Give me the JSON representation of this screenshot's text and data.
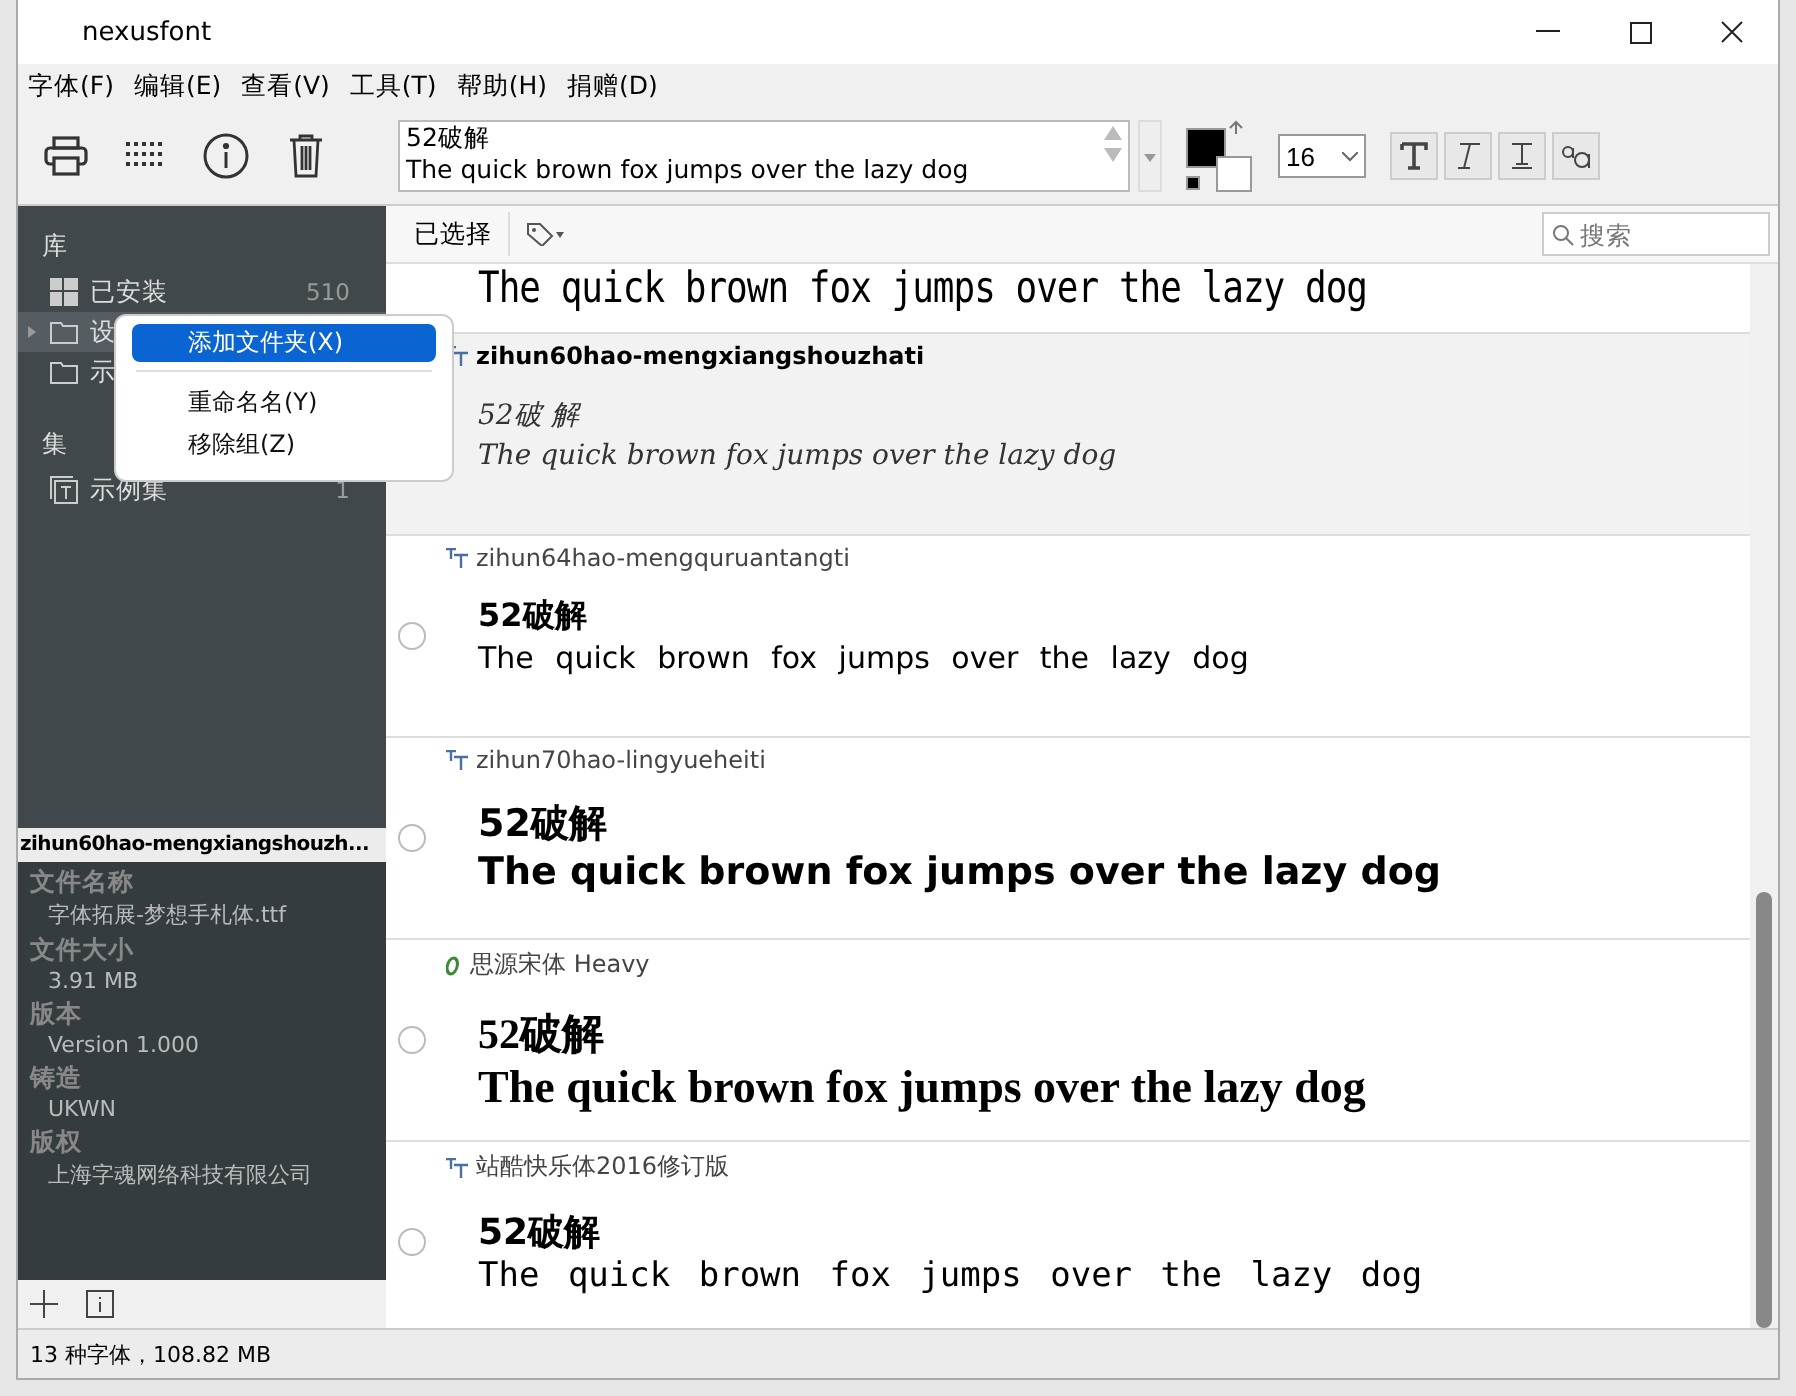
{
  "window": {
    "title": "nexusfont"
  },
  "menu": [
    "字体(F)",
    "编辑(E)",
    "查看(V)",
    "工具(T)",
    "帮助(H)",
    "捐赠(D)"
  ],
  "toolbar": {
    "preview_lines": [
      "52破解",
      "The quick brown fox jumps over the lazy dog"
    ],
    "size": "16"
  },
  "sidebar": {
    "sections": [
      {
        "title": "库",
        "items": [
          {
            "kind": "windows",
            "label": "已安装",
            "count": "510",
            "selected": false
          },
          {
            "kind": "folder",
            "label": "设",
            "selected": true,
            "expandable": true
          },
          {
            "kind": "folder",
            "label": "示",
            "selected": false
          }
        ]
      },
      {
        "title": "集",
        "items": [
          {
            "kind": "set",
            "label": "示例集",
            "count": "1",
            "selected": false
          }
        ]
      }
    ]
  },
  "context_menu": [
    {
      "label": "添加文件夹(X)",
      "selected": true
    },
    {
      "label": "重命名名(Y)",
      "selected": false
    },
    {
      "label": "移除组(Z)",
      "selected": false
    }
  ],
  "details": {
    "title": "zihun60hao-mengxiangshouzh...",
    "fields": [
      {
        "label": "文件名称",
        "value": "字体拓展-梦想手札体.ttf"
      },
      {
        "label": "文件大小",
        "value": "3.91 MB"
      },
      {
        "label": "版本",
        "value": "Version 1.000"
      },
      {
        "label": "铸造",
        "value": "UKWN"
      },
      {
        "label": "版权",
        "value": "上海字魂网络科技有限公司"
      }
    ]
  },
  "list_toolbar": {
    "selected_button": "已选择",
    "search_placeholder": "搜索"
  },
  "fonts": [
    {
      "kind": "partial",
      "sample": "The quick brown fox jumps over the lazy dog",
      "selected": false
    },
    {
      "kind": "truetype",
      "name": "zihun60hao-mengxiangshouzhati",
      "title": "52破 解",
      "sample": "The quick brown fox jumps over the lazy dog",
      "selected": true
    },
    {
      "kind": "truetype",
      "name": "zihun64hao-mengquruantangti",
      "title": "52破解",
      "sample": "The quick brown fox jumps over the lazy dog",
      "selected": false
    },
    {
      "kind": "truetype",
      "name": "zihun70hao-lingyueheiti",
      "title": "52破解",
      "sample": "The quick brown fox jumps over the lazy dog",
      "selected": false
    },
    {
      "kind": "opentype",
      "name": "思源宋体 Heavy",
      "title": "52破解",
      "sample": "The quick brown fox jumps over the lazy dog",
      "selected": false
    },
    {
      "kind": "truetype",
      "name": "站酷快乐体2016修订版",
      "title": "52破解",
      "sample": "The quick brown fox jumps over the lazy dog",
      "selected": false
    }
  ],
  "status_bar": "13 种字体，108.82 MB"
}
